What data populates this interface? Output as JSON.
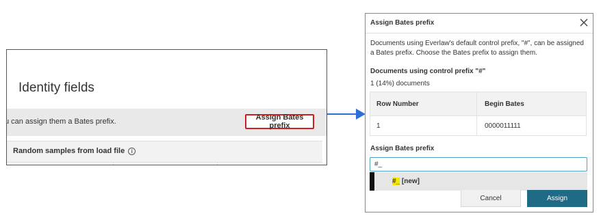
{
  "left_panel": {
    "title": "Identity fields",
    "banner_text": "u can assign them a Bates prefix.",
    "assign_button": "Assign Bates prefix",
    "samples_title": "Random samples from load file",
    "info_icon": "i"
  },
  "colors": {
    "highlight_border": "#cc1f1f",
    "arrow": "#2d6fd6",
    "primary_button": "#1f6b86",
    "input_focus": "#4aa3c4",
    "match_highlight": "#f3e600"
  },
  "dialog": {
    "title": "Assign Bates prefix",
    "close_icon": "×",
    "description": "Documents using Everlaw's default control prefix, \"#\", can be assigned a Bates prefix. Choose the Bates prefix to assign them.",
    "subheading": "Documents using control prefix \"#\"",
    "count": "1 (14%) documents",
    "table": {
      "headers": [
        "Row Number",
        "Begin Bates"
      ],
      "rows": [
        [
          "1",
          "0000011111"
        ]
      ]
    },
    "assign_label": "Assign Bates prefix",
    "input_value": "#_",
    "suggestion_match": "#_",
    "suggestion_rest": " [new]",
    "cancel_label": "Cancel",
    "assign_label_btn": "Assign"
  }
}
